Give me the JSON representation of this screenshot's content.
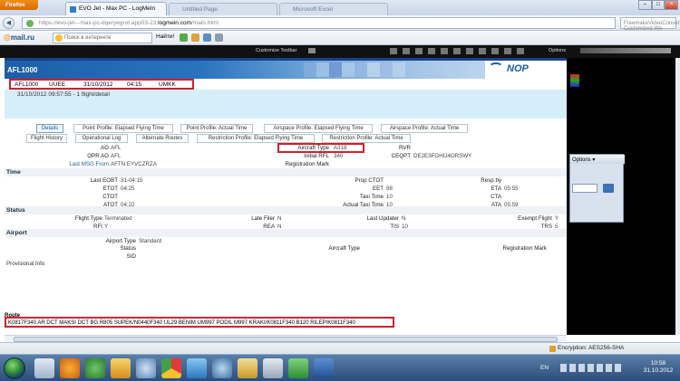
{
  "browser": {
    "menu_button": "Firefox",
    "tabs": [
      {
        "label": "EVO Jet - Max PC - LogMeIn",
        "active": true
      },
      {
        "label": "Untitled Page",
        "active": false
      },
      {
        "label": "Microsoft Excel",
        "active": false
      }
    ],
    "url_prefix": "https://evo-jet---max-pc-dqeryegrot.app03-23.",
    "url_domain": "logmein.com",
    "url_suffix": "/main.html",
    "search_placeholder": "FreemakeVideoConverterTB Customized We"
  },
  "mailru_toolbar": {
    "logo": "mail.ru",
    "search_placeholder": "Поиск в интернете",
    "search_button": "Найти!"
  },
  "logmein_bar": {
    "customize": "Customize Toolbar",
    "options": "Options"
  },
  "page": {
    "flight_id": "AFL1000",
    "logo_text": "NOP",
    "flight_row": {
      "flight": "AFL1000",
      "dep": "UUEE",
      "date": "31/10/2012",
      "time": "04:15",
      "arr": "UMKK"
    },
    "subtitle": "31/10/2012 09:57:55 - 1 flight/detail",
    "tabs_row1": [
      {
        "label": "Details",
        "active": true
      },
      {
        "label": "Point Profile: Elapsed Flying Time"
      },
      {
        "label": "Point Profile: Actual Time"
      },
      {
        "label": "Airspace Profile: Elapsed Flying Time"
      },
      {
        "label": "Airspace Profile: Actual Time"
      }
    ],
    "tabs_row2": [
      {
        "label": "Flight History"
      },
      {
        "label": "Operational Log"
      },
      {
        "label": "Alternate Routes"
      },
      {
        "label": "Restriction Profile: Elapsed Flying Time"
      },
      {
        "label": "Restriction Profile: Actual Time"
      }
    ],
    "general": {
      "ao_label": "AO",
      "ao_value": "AFL",
      "opr_ao_label": "OPR AO",
      "opr_ao_value": "AFL",
      "last_msg_label": "Last MSG From",
      "last_msg_value": "AFTN:EYVCZRZA",
      "aircraft_type_label": "Aircraft Type",
      "aircraft_type_value": "A318",
      "initial_rfl_label": "Initial RFL",
      "initial_rfl_value": "340",
      "reg_mark_label": "Registration Mark",
      "rvr_label": "RVR",
      "ceqpt_label": "CEQPT",
      "ceqpt_value": "DE2E3FGHIJ4ORSWY"
    },
    "time_section": "Time",
    "time": {
      "last_eobt_label": "Last EOBT",
      "last_eobt_value": "31-04:15",
      "etot_label": "ETOT",
      "etot_value": "04:25",
      "ctot_label": "CTOT",
      "atot_label": "ATOT",
      "atot_value": "04:22",
      "prop_ctot_label": "Prop CTOT",
      "eet_label": "EET",
      "eet_value": "98",
      "taxi_label": "Taxi Time",
      "taxi_value": "10",
      "actual_taxi_label": "Actual Taxi Time",
      "actual_taxi_value": "10",
      "resp_by_label": "Resp by",
      "eta_label": "ETA",
      "eta_value": "05:55",
      "cta_label": "CTA",
      "ata_label": "ATA",
      "ata_value": "05:59"
    },
    "status_section": "Status",
    "status": {
      "flight_type_label": "Flight Type",
      "flight_type_value": "Terminated",
      "rfi_label": "RFI",
      "rfi_value": "Y",
      "late_filer_label": "Late Filer",
      "late_filer_value": "N",
      "rea_label": "REA",
      "rea_value": "N",
      "last_updater_label": "Last Updater",
      "last_updater_value": "N",
      "tis_label": "TIS",
      "tis_value": "10",
      "exempt_flight_label": "Exempt Flight",
      "exempt_flight_value": "Y",
      "trs_label": "TRS",
      "trs_value": "5"
    },
    "airport_section": "Airport",
    "airport": {
      "airport_type_label": "Airport Type",
      "airport_type_value": "Standard",
      "status_label": "Status",
      "sid_label": "SID",
      "aircraft_type_label": "Aircraft Type",
      "reg_mark_label": "Registration Mark"
    },
    "provisional_info": "Provisional Info",
    "route_label": "Route",
    "route_value": "K0817F340 AR DCT MAKSI DCT BG R805 SUPEK/N0440F340 UL29 BENIM UM997 PODIL M997 KRAKI/K0811F340 B120 RILEP/K0811F340"
  },
  "side_panel": {
    "options_label": "Options"
  },
  "statusbar": {
    "encryption": "Encryption: AES256-SHA"
  },
  "taskbar": {
    "lang": "EN",
    "time": "10:58",
    "date": "31.10.2012"
  },
  "colors": {
    "accent": "#1c5ea6",
    "highlight_box": "#d11f2f",
    "subheader_bg": "#d6eef8"
  }
}
